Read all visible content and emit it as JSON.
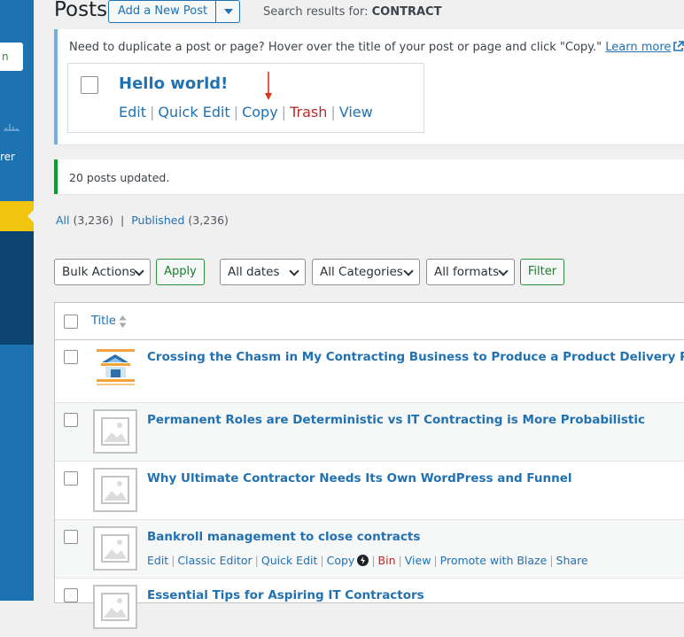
{
  "sidebar": {
    "button_fragment": "n",
    "label_fragment": "rer",
    "colors": {
      "bg": "#1d73b2",
      "active": "#f1c40f",
      "dark": "#0b4471"
    }
  },
  "header": {
    "title": "Posts",
    "add_new_label": "Add a New Post",
    "search_prefix": "Search results for: ",
    "search_term": "CONTRACT"
  },
  "copy_notice": {
    "text": "Need to duplicate a post or page? Hover over the title of your post or page and click \"Copy.\"",
    "link": "Learn more",
    "demo_title": "Hello world!",
    "demo_actions": {
      "edit": "Edit",
      "quick_edit": "Quick Edit",
      "copy": "Copy",
      "trash": "Trash",
      "view": "View"
    }
  },
  "updated_notice": {
    "text": "20 posts updated."
  },
  "status_filters": {
    "all_label": "All",
    "all_count": "(3,236)",
    "separator": "|",
    "published_label": "Published",
    "published_count": "(3,236)"
  },
  "tablenav": {
    "bulk_actions": "Bulk Actions",
    "apply": "Apply",
    "dates": "All dates",
    "categories": "All Categories",
    "formats": "All formats",
    "filter": "Filter"
  },
  "table": {
    "column_title": "Title",
    "rows": [
      {
        "title": "Crossing the Chasm in My Contracting Business to Produce a Product Delivery Pilot"
      },
      {
        "title": "Permanent Roles are Deterministic vs IT Contracting is More Probabilistic"
      },
      {
        "title": "Why Ultimate Contractor Needs Its Own WordPress and Funnel"
      },
      {
        "title": "Bankroll management to close contracts",
        "actions": {
          "edit": "Edit",
          "classic_editor": "Classic Editor",
          "quick_edit": "Quick Edit",
          "copy": "Copy",
          "bin": "Bin",
          "view": "View",
          "promote": "Promote with Blaze",
          "share": "Share"
        }
      },
      {
        "title": "Essential Tips for Aspiring IT Contractors"
      }
    ]
  },
  "colors": {
    "link": "#2271b1",
    "danger": "#b32d2e",
    "success": "#00a32a",
    "info": "#72aee6"
  }
}
